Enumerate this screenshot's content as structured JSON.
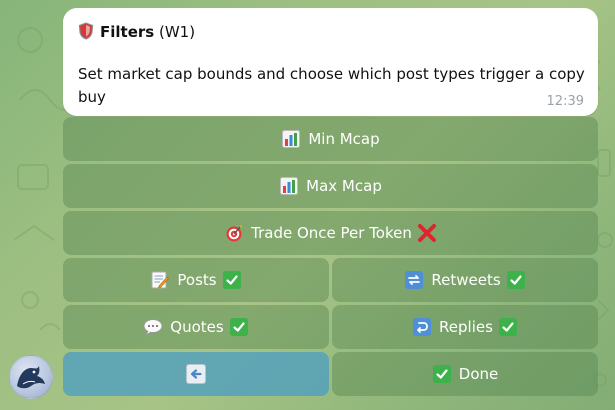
{
  "message": {
    "title": "Filters",
    "title_suffix": "(W1)",
    "text": "Set market cap bounds and choose which post types trigger a copy buy",
    "time": "12:39"
  },
  "keyboard": {
    "min_mcap": "Min Mcap",
    "max_mcap": "Max Mcap",
    "trade_once": "Trade Once Per Token",
    "posts": "Posts",
    "retweets": "Retweets",
    "quotes": "Quotes",
    "replies": "Replies",
    "done": "Done"
  },
  "icons": {
    "title_icon": "shield-icon",
    "min_mcap": "bar-chart-icon",
    "max_mcap": "bar-chart-icon",
    "trade_once": "target-icon",
    "trade_once_state": "cross-mark-icon",
    "posts": "memo-icon",
    "posts_state": "check-mark-icon",
    "retweets": "repeat-icon",
    "retweets_state": "check-mark-icon",
    "quotes": "speech-bubble-icon",
    "quotes_state": "check-mark-icon",
    "replies": "return-arrow-icon",
    "replies_state": "check-mark-icon",
    "back": "left-arrow-icon",
    "done": "check-mark-icon"
  },
  "colors": {
    "bubble": "#ffffff",
    "button": "#6a9a5f",
    "back_button": "#4e9ec0",
    "check": "#3db14a",
    "cross": "#e0232e"
  }
}
